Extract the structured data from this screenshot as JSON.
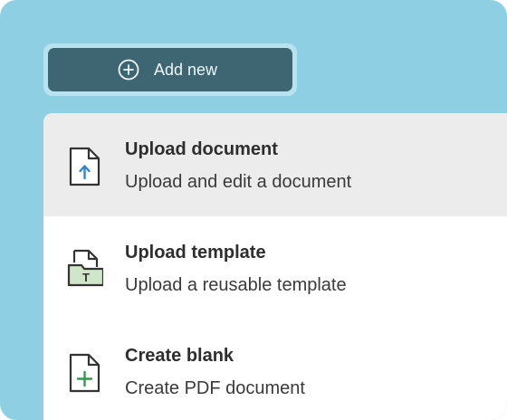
{
  "add_button": {
    "label": "Add new",
    "icon": "plus-circle-icon"
  },
  "menu": {
    "items": [
      {
        "title": "Upload document",
        "description": "Upload and edit a document",
        "icon": "upload-document-icon",
        "highlighted": true
      },
      {
        "title": "Upload template",
        "description": "Upload a reusable template",
        "icon": "template-folder-icon",
        "highlighted": false
      },
      {
        "title": "Create blank",
        "description": "Create PDF document",
        "icon": "blank-document-plus-icon",
        "highlighted": false
      }
    ]
  },
  "colors": {
    "panel_background": "#8ecfe3",
    "button_background": "#3e6672",
    "highlight_row": "#ececec",
    "upload_arrow": "#2a86d8",
    "template_fill": "#cfe6c8",
    "create_plus": "#2f9a4e"
  }
}
